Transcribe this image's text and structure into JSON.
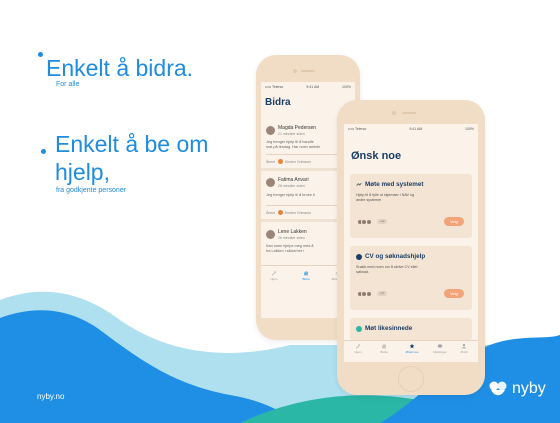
{
  "slide": {
    "bullets": [
      {
        "title": "Enkelt å bidra.",
        "subtitle": "For alle"
      },
      {
        "title_line1": "Enkelt å be om",
        "title_line2": "hjelp,",
        "subtitle": "fra godkjente personer"
      }
    ],
    "footer_url": "nyby.no",
    "brand_name": "nyby",
    "colors": {
      "accent": "#1e8ce0",
      "wave_blue": "#1f8fe5",
      "wave_teal": "#2bb7a6",
      "wave_light": "#aee0f0",
      "phone": "#f1ddc6",
      "velg": "#f2a379"
    }
  },
  "phone_back": {
    "status": {
      "carrier": "••••• Telenor",
      "time": "9:41 AM",
      "battery": "100%"
    },
    "title": "Bidra",
    "posts": [
      {
        "name": "Magda Pedersen",
        "time": "21 minutter siden",
        "body_line1": "Jeg trenger hjelp til å handle",
        "body_line2": "mat på tirsdag. Har noen anledn",
        "footer_label": "Åbent",
        "footer_person": "Kirsten Grimsom"
      },
      {
        "name": "Fatima Anvari",
        "time": "28 minutter siden",
        "body_line1": "Jeg trenger hjelp til å bruke ti",
        "footer_label": "Åbent",
        "footer_person": "Kirsten Grimsom"
      },
      {
        "name": "Lene Lakken",
        "time": "26 minutter siden",
        "body_line1": "Kan noen hjelpe meg med å",
        "body_line2": "fra Lakken i sikkerhet i"
      }
    ],
    "tabs": [
      "Hjem",
      "Bidra",
      "Ønsk noe"
    ]
  },
  "phone_front": {
    "status": {
      "carrier": "••••• Telenor",
      "time": "9:41 AM",
      "battery": "100%"
    },
    "title": "Ønsk noe",
    "cards": [
      {
        "title": "Møte med systemet",
        "body_line1": "Hjelp til å fylle ut skjemaer i NAV og",
        "body_line2": "andre systemer",
        "count": "+12",
        "button": "Velg"
      },
      {
        "title": "CV og søknadshjelp",
        "body_line1": "Snakk med noen om å skrive CV eller",
        "body_line2": "søknad.",
        "count": "+37",
        "button": "Velg"
      },
      {
        "title": "Møt likesinnede"
      }
    ],
    "tabs": [
      "Hjem",
      "Bidra",
      "Ønsk noe",
      "Meldinger",
      "Profil"
    ]
  }
}
